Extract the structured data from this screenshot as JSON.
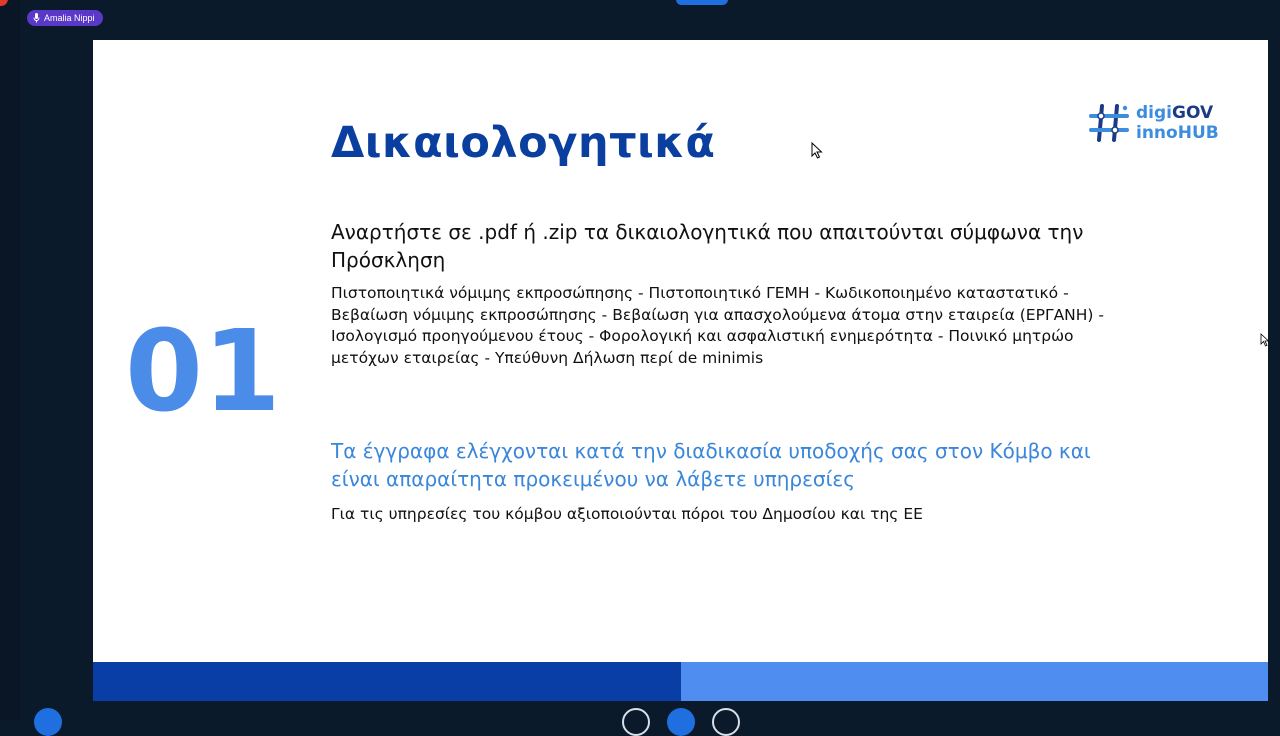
{
  "participant": {
    "name": "Amalia Nippi",
    "icon": "mic-icon"
  },
  "slide": {
    "title": "Δικαιολογητικά",
    "logo": {
      "line1_a": "digi",
      "line1_b": "GOV",
      "line2": "innoHUB",
      "icon": "hashtag-logo-icon"
    },
    "number": "01",
    "instruction": "Αναρτήστε σε .pdf ή .zip τα δικαιολογητικά που απαιτούνται σύμφωνα την Πρόσκληση",
    "documents": "Πιστοποιητικά νόμιμης εκπροσώπησης - Πιστοποιητικό ΓΕΜΗ - Κωδικοποιημένο καταστατικό - Βεβαίωση νόμιμης εκπροσώπησης - Βεβαίωση για απασχολούμενα άτομα στην εταιρεία (ΕΡΓΑΝΗ) - Ισολογισμό προηγούμενου έτους - Φορολογική και ασφαλιστική ενημερότητα - Ποινικό μητρώο μετόχων εταιρείας - Υπεύθυνη Δήλωση περί de minimis",
    "notice": "Τα έγγραφα ελέγχονται κατά την διαδικασία υποδοχής σας στον Κόμβο και είναι απαραίτητα προκειμένου να λάβετε υπηρεσίες",
    "funding": "Για τις υπηρεσίες του κόμβου αξιοποιούνται πόροι του Δημοσίου και της ΕΕ"
  },
  "colors": {
    "title": "#0a3fa0",
    "number": "#4a8ce8",
    "notice": "#3a86da",
    "footer_dark": "#0a3ea7",
    "footer_light": "#4f8ef0",
    "background": "#0b1a2b"
  }
}
